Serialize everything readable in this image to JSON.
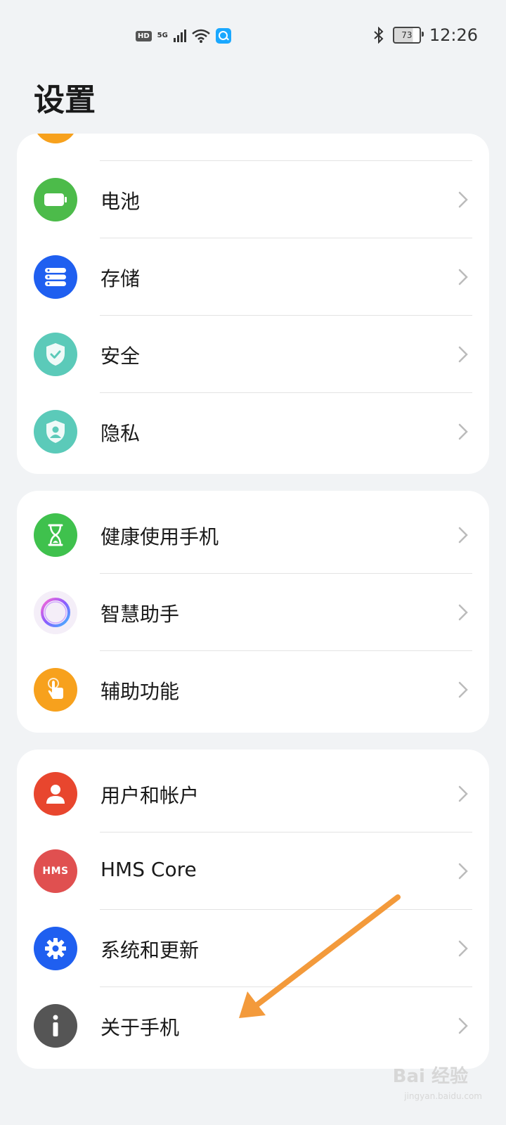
{
  "status_bar": {
    "hd": "HD",
    "network": "5G",
    "battery": "73",
    "time": "12:26"
  },
  "title": "设置",
  "groups": [
    {
      "items": [
        {
          "label": "电池",
          "icon": "battery-icon",
          "color": "#4cbb4a"
        },
        {
          "label": "存储",
          "icon": "storage-icon",
          "color": "#1f5ff0"
        },
        {
          "label": "安全",
          "icon": "security-shield-icon",
          "color": "#5bcab9"
        },
        {
          "label": "隐私",
          "icon": "privacy-shield-icon",
          "color": "#5bcab9"
        }
      ]
    },
    {
      "items": [
        {
          "label": "健康使用手机",
          "icon": "hourglass-icon",
          "color": "#3fc14d"
        },
        {
          "label": "智慧助手",
          "icon": "assistant-ring-icon",
          "color": "#f4eef8"
        },
        {
          "label": "辅助功能",
          "icon": "hand-touch-icon",
          "color": "#f7a11d"
        }
      ]
    },
    {
      "items": [
        {
          "label": "用户和帐户",
          "icon": "user-icon",
          "color": "#e8462e"
        },
        {
          "label": "HMS Core",
          "icon": "hms-core-icon",
          "color": "#e05050"
        },
        {
          "label": "系统和更新",
          "icon": "gear-icon",
          "color": "#1f5ff0"
        },
        {
          "label": "关于手机",
          "icon": "info-icon",
          "color": "#555555"
        }
      ]
    }
  ],
  "hms_icon_text": "HMS",
  "watermark": {
    "text": "Bai 经验",
    "url": "jingyan.baidu.com"
  },
  "annotation_color": "#f39a3b"
}
